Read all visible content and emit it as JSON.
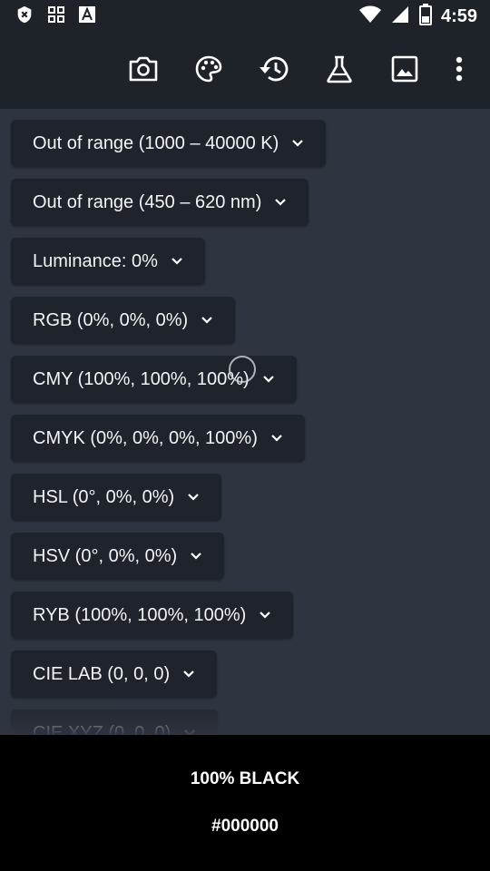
{
  "status_bar": {
    "time": "4:59",
    "icons": [
      "close-badge-icon",
      "grid-icon",
      "text-a-icon",
      "wifi-icon",
      "signal-icon",
      "battery-icon"
    ]
  },
  "toolbar": {
    "actions": [
      "camera-icon",
      "palette-icon",
      "history-icon",
      "flask-icon",
      "image-icon",
      "more-vert-icon"
    ]
  },
  "color_items": [
    {
      "label": "Out of range (1000 – 40000 K)"
    },
    {
      "label": "Out of range (450 – 620 nm)"
    },
    {
      "label": "Luminance: 0%"
    },
    {
      "label": "RGB (0%, 0%, 0%)"
    },
    {
      "label": "CMY (100%, 100%, 100%)"
    },
    {
      "label": "CMYK (0%, 0%, 0%, 100%)"
    },
    {
      "label": "HSL (0°, 0%, 0%)"
    },
    {
      "label": "HSV (0°, 0%, 0%)"
    },
    {
      "label": "RYB (100%, 100%, 100%)"
    },
    {
      "label": "CIE LAB (0, 0, 0)"
    },
    {
      "label": "CIE XYZ (0, 0, 0)"
    }
  ],
  "footer": {
    "color_name": "100% BLACK",
    "hex": "#000000"
  },
  "colors": {
    "background": "#2e3440",
    "bar": "#1e2229",
    "chip": "#1f232b",
    "swatch": "#000000"
  }
}
